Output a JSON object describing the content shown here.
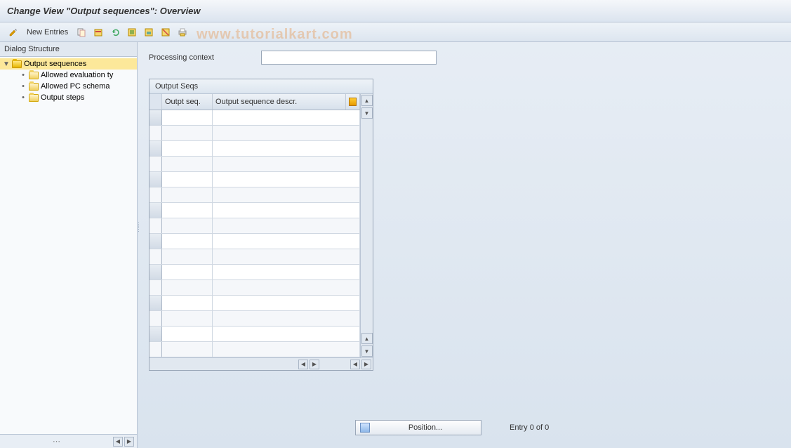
{
  "title": "Change View \"Output sequences\": Overview",
  "toolbar": {
    "new_entries_label": "New Entries"
  },
  "watermark": "www.tutorialkart.com",
  "sidebar": {
    "header": "Dialog Structure",
    "root": {
      "label": "Output sequences",
      "expanded": true,
      "children": [
        {
          "label": "Allowed evaluation ty"
        },
        {
          "label": "Allowed PC schema"
        },
        {
          "label": "Output steps"
        }
      ]
    }
  },
  "content": {
    "processing_context_label": "Processing context",
    "processing_context_value": ""
  },
  "table": {
    "title": "Output Seqs",
    "columns": [
      {
        "label": "Outpt seq."
      },
      {
        "label": "Output sequence descr."
      }
    ],
    "row_count": 16,
    "rows": []
  },
  "footer": {
    "position_button": "Position...",
    "entry_text": "Entry 0 of 0"
  }
}
